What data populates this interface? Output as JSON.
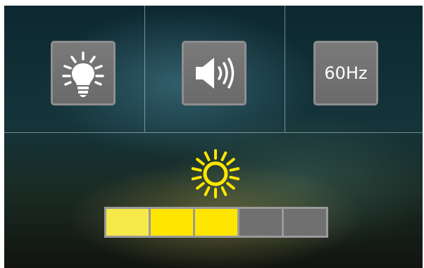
{
  "quick_settings": {
    "buttons": [
      {
        "id": "backlight",
        "icon": "lightbulb-icon"
      },
      {
        "id": "volume",
        "icon": "speaker-icon"
      },
      {
        "id": "refresh_rate",
        "label": "60Hz"
      }
    ]
  },
  "brightness": {
    "icon": "sun-icon",
    "level": 3,
    "max_level": 5,
    "colors": {
      "first_segment": "#f6e94a",
      "active": "#ffe600",
      "inactive": "#707070",
      "sun": "#ffe600"
    }
  }
}
